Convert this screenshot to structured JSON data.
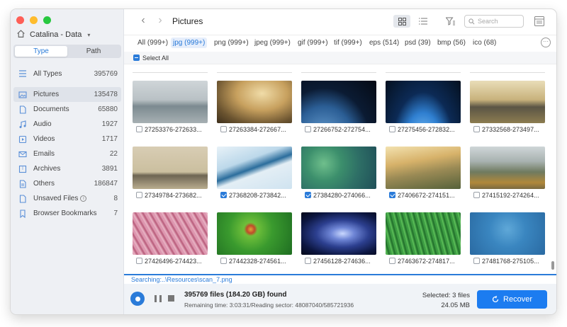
{
  "window": {
    "drive_label": "Catalina - Data",
    "tabs": [
      {
        "label": "Type"
      },
      {
        "label": "Path"
      }
    ],
    "title": "Pictures"
  },
  "sidebar": {
    "items": [
      {
        "label": "All Types",
        "count": "395769",
        "icon": "grid-icon"
      },
      {
        "label": "Pictures",
        "count": "135478",
        "icon": "image-icon"
      },
      {
        "label": "Documents",
        "count": "65880",
        "icon": "document-icon"
      },
      {
        "label": "Audio",
        "count": "1927",
        "icon": "music-icon"
      },
      {
        "label": "Videos",
        "count": "1717",
        "icon": "video-icon"
      },
      {
        "label": "Emails",
        "count": "22",
        "icon": "mail-icon"
      },
      {
        "label": "Archives",
        "count": "3891",
        "icon": "archive-icon"
      },
      {
        "label": "Others",
        "count": "186847",
        "icon": "others-icon"
      },
      {
        "label": "Unsaved Files",
        "count": "8",
        "icon": "unsaved-icon"
      },
      {
        "label": "Browser Bookmarks",
        "count": "7",
        "icon": "bookmark-icon"
      }
    ]
  },
  "search": {
    "placeholder": "Search"
  },
  "filters": [
    {
      "label": "All (999+)"
    },
    {
      "label": "jpg (999+)"
    },
    {
      "label": "png (999+)"
    },
    {
      "label": "jpeg (999+)"
    },
    {
      "label": "gif (999+)"
    },
    {
      "label": "tif (999+)"
    },
    {
      "label": "eps (514)"
    },
    {
      "label": "psd (39)"
    },
    {
      "label": "bmp (56)"
    },
    {
      "label": "ico (68)"
    }
  ],
  "select_all_label": "Select All",
  "tiles": [
    {
      "name": "27253376-272633...",
      "checked": false
    },
    {
      "name": "27263384-272667...",
      "checked": false
    },
    {
      "name": "27266752-272754...",
      "checked": false
    },
    {
      "name": "27275456-272832...",
      "checked": false
    },
    {
      "name": "27332568-273497...",
      "checked": false
    },
    {
      "name": "27349784-273682...",
      "checked": false
    },
    {
      "name": "27368208-273842...",
      "checked": true
    },
    {
      "name": "27384280-274066...",
      "checked": true
    },
    {
      "name": "27406672-274151...",
      "checked": true
    },
    {
      "name": "27415192-274264...",
      "checked": false
    },
    {
      "name": "27426496-274423...",
      "checked": false
    },
    {
      "name": "27442328-274561...",
      "checked": false
    },
    {
      "name": "27456128-274636...",
      "checked": false
    },
    {
      "name": "27463672-274817...",
      "checked": false
    },
    {
      "name": "27481768-275105...",
      "checked": false
    }
  ],
  "status": {
    "searching_path": "Searching:..\\Resources\\scan_7.png",
    "found": "395769 files (184.20 GB) found",
    "remaining": "Remaining time: 3:03:31/Reading sector: 48087040/585721936",
    "selected_count": "Selected: 3 files",
    "selected_size": "24.05 MB",
    "recover_label": "Recover"
  },
  "colors": {
    "accent": "#1c7cf0",
    "sidebar_bg": "#eef0f4"
  }
}
